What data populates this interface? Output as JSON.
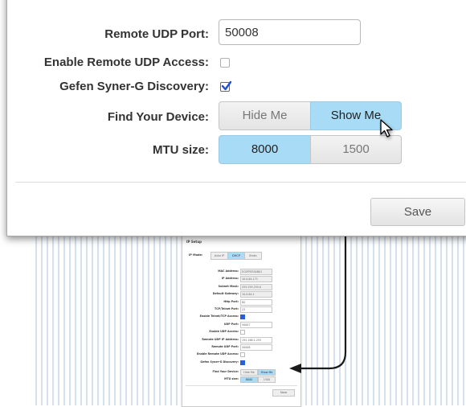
{
  "panel": {
    "remote_udp_port": {
      "label": "Remote UDP Port:",
      "value": "50008"
    },
    "enable_remote_udp_access": {
      "label": "Enable Remote UDP Access:",
      "checked": false
    },
    "gefen_discovery": {
      "label": "Gefen Syner-G Discovery:",
      "checked": true
    },
    "find_device": {
      "label": "Find Your Device:",
      "hide": "Hide Me",
      "show": "Show Me",
      "selected": "Show Me"
    },
    "mtu": {
      "label": "MTU size:",
      "opt1": "8000",
      "opt2": "1500",
      "selected": "8000"
    },
    "save_label": "Save"
  },
  "mini": {
    "title": "IP Setup",
    "ip_mode_label": "IP Mode:",
    "modes": [
      "Auto IP",
      "DHCP",
      "Static"
    ],
    "selected_mode": "DHCP",
    "rows": [
      {
        "label": "MAC Address:",
        "value": "EC0FFEE0AB01",
        "readonly": true
      },
      {
        "label": "IP Address:",
        "value": "10.0.64.171",
        "readonly": true
      },
      {
        "label": "Subnet Mask:",
        "value": "255.255.255.0",
        "readonly": true
      },
      {
        "label": "Default Gateway:",
        "value": "10.0.64.1",
        "readonly": true
      },
      {
        "label": "Http Port:",
        "value": "80",
        "readonly": false
      },
      {
        "label": "TCP/Telnet Port:",
        "value": "23",
        "readonly": false
      },
      {
        "label": "Enable Telnet/TCP Access:",
        "checkbox": true,
        "checked": true
      },
      {
        "label": "UDP Port:",
        "value": "50007",
        "readonly": false
      },
      {
        "label": "Enable UDP Access:",
        "checkbox": true,
        "checked": false
      },
      {
        "label": "Remote UDP IP Address:",
        "value": "192.168.1.255",
        "readonly": false
      },
      {
        "label": "Remote UDP Port:",
        "value": "50008",
        "readonly": false
      },
      {
        "label": "Enable Remote UDP Access:",
        "checkbox": true,
        "checked": false
      },
      {
        "label": "Gefen Syner-G Discovery:",
        "checkbox": true,
        "checked": true
      }
    ],
    "find_label": "Find Your Device:",
    "find_hide": "Hide Me",
    "find_show": "Show Me",
    "mtu_label": "MTU size:",
    "mtu_1": "8000",
    "mtu_2": "1500",
    "save_label": "Save"
  },
  "colors": {
    "selected": "#a8dcf6",
    "accent": "#2b5fd6",
    "arrow": "#1a1a1a"
  }
}
